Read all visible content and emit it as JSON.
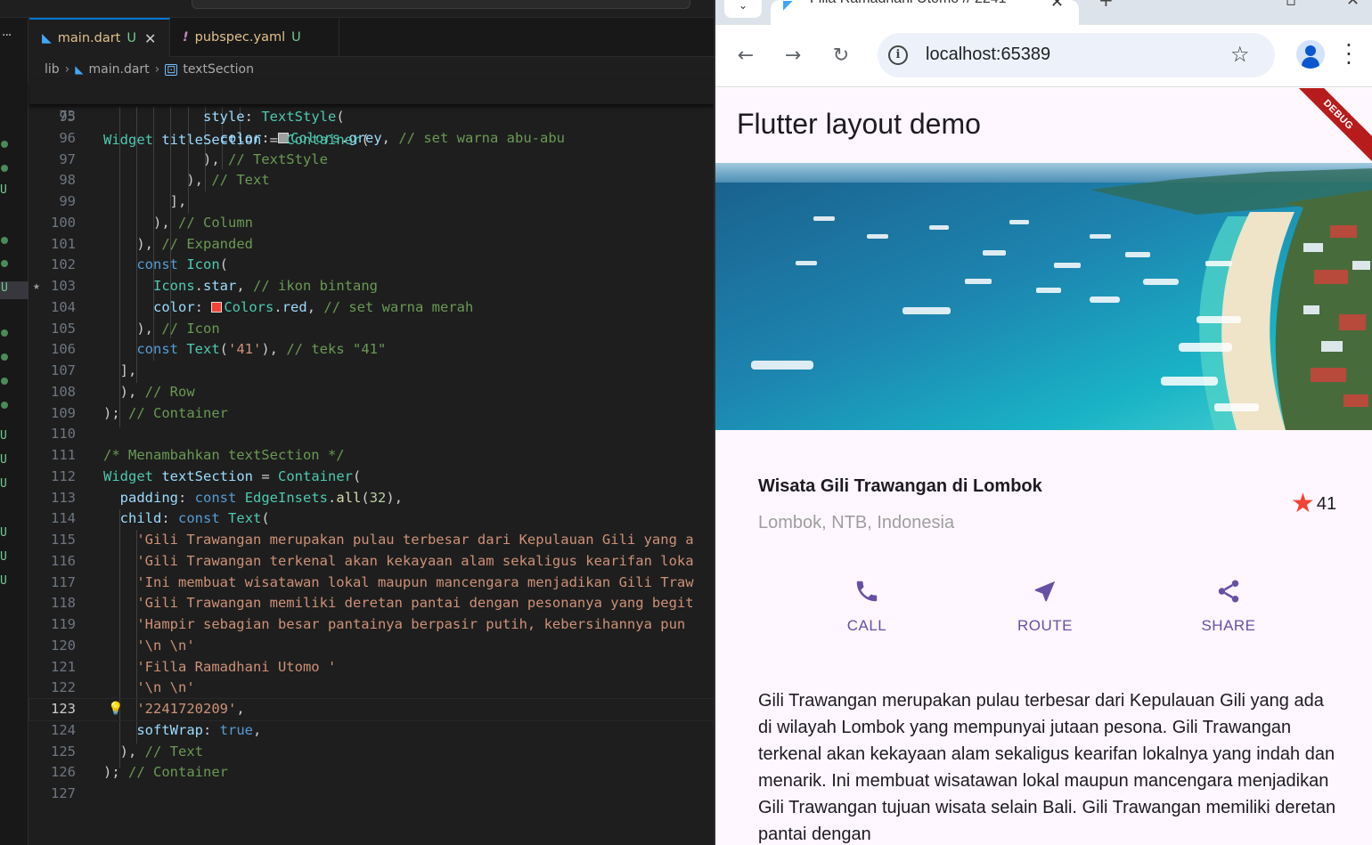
{
  "editor": {
    "tabs": [
      {
        "name": "main.dart",
        "status": "U"
      },
      {
        "name": "pubspec.yaml",
        "status": "U"
      }
    ],
    "breadcrumb": [
      "lib",
      "main.dart",
      "textSection"
    ],
    "sticky": {
      "num": "73",
      "text": "Widget titleSection = Container("
    },
    "gutter_marks": [
      "U",
      "U",
      "U",
      "U",
      "U",
      "U",
      "U",
      "U"
    ],
    "lines": [
      {
        "num": "95",
        "text": "            style: TextStyle("
      },
      {
        "num": "96",
        "text": "              color: Colors.grey, // set warna abu-abu"
      },
      {
        "num": "97",
        "text": "            ), // TextStyle"
      },
      {
        "num": "98",
        "text": "          ), // Text"
      },
      {
        "num": "99",
        "text": "        ],"
      },
      {
        "num": "100",
        "text": "      ), // Column"
      },
      {
        "num": "101",
        "text": "    ), // Expanded"
      },
      {
        "num": "102",
        "text": "    const Icon("
      },
      {
        "num": "103",
        "text": "      Icons.star, // ikon bintang"
      },
      {
        "num": "104",
        "text": "      color: Colors.red, // set warna merah"
      },
      {
        "num": "105",
        "text": "    ), // Icon"
      },
      {
        "num": "106",
        "text": "    const Text('41'), // teks \"41\""
      },
      {
        "num": "107",
        "text": "  ],"
      },
      {
        "num": "108",
        "text": "  ), // Row"
      },
      {
        "num": "109",
        "text": "); // Container"
      },
      {
        "num": "110",
        "text": ""
      },
      {
        "num": "111",
        "text": "/* Menambahkan textSection */"
      },
      {
        "num": "112",
        "text": "Widget textSection = Container("
      },
      {
        "num": "113",
        "text": "  padding: const EdgeInsets.all(32),"
      },
      {
        "num": "114",
        "text": "  child: const Text("
      },
      {
        "num": "115",
        "text": "    'Gili Trawangan merupakan pulau terbesar dari Kepulauan Gili yang a"
      },
      {
        "num": "116",
        "text": "    'Gili Trawangan terkenal akan kekayaan alam sekaligus kearifan loka"
      },
      {
        "num": "117",
        "text": "    'Ini membuat wisatawan lokal maupun mancengara menjadikan Gili Traw"
      },
      {
        "num": "118",
        "text": "    'Gili Trawangan memiliki deretan pantai dengan pesonanya yang begit"
      },
      {
        "num": "119",
        "text": "    'Hampir sebagian besar pantainya berpasir putih, kebersihannya pun"
      },
      {
        "num": "120",
        "text": "    '\\n \\n'"
      },
      {
        "num": "121",
        "text": "    'Filla Ramadhani Utomo '"
      },
      {
        "num": "122",
        "text": "    '\\n \\n'"
      },
      {
        "num": "123",
        "text": "    '2241720209',"
      },
      {
        "num": "124",
        "text": "    softWrap: true,"
      },
      {
        "num": "125",
        "text": "  ), // Text"
      },
      {
        "num": "126",
        "text": "); // Container"
      },
      {
        "num": "127",
        "text": ""
      }
    ]
  },
  "browser": {
    "tab_title": "Filla Ramadhani Utomo // 2241",
    "url": "localhost:65389"
  },
  "app": {
    "title": "Flutter layout demo",
    "debug_banner": "DEBUG",
    "place_name": "Wisata Gili Trawangan di Lombok",
    "location": "Lombok, NTB, Indonesia",
    "rating": "41",
    "actions": [
      {
        "label": "CALL",
        "icon": "phone-icon"
      },
      {
        "label": "ROUTE",
        "icon": "near-me-icon"
      },
      {
        "label": "SHARE",
        "icon": "share-icon"
      }
    ],
    "description": "Gili Trawangan merupakan pulau terbesar dari Kepulauan Gili yang ada di wilayah Lombok yang mempunyai jutaan pesona. Gili Trawangan terkenal akan kekayaan alam sekaligus kearifan lokalnya yang indah dan menarik. Ini membuat wisatawan lokal maupun mancengara menjadikan Gili Trawangan tujuan wisata selain Bali. Gili Trawangan memiliki deretan pantai dengan",
    "colors": {
      "primary": "#6750a4",
      "star": "#f44336",
      "background": "#fef7ff"
    }
  }
}
